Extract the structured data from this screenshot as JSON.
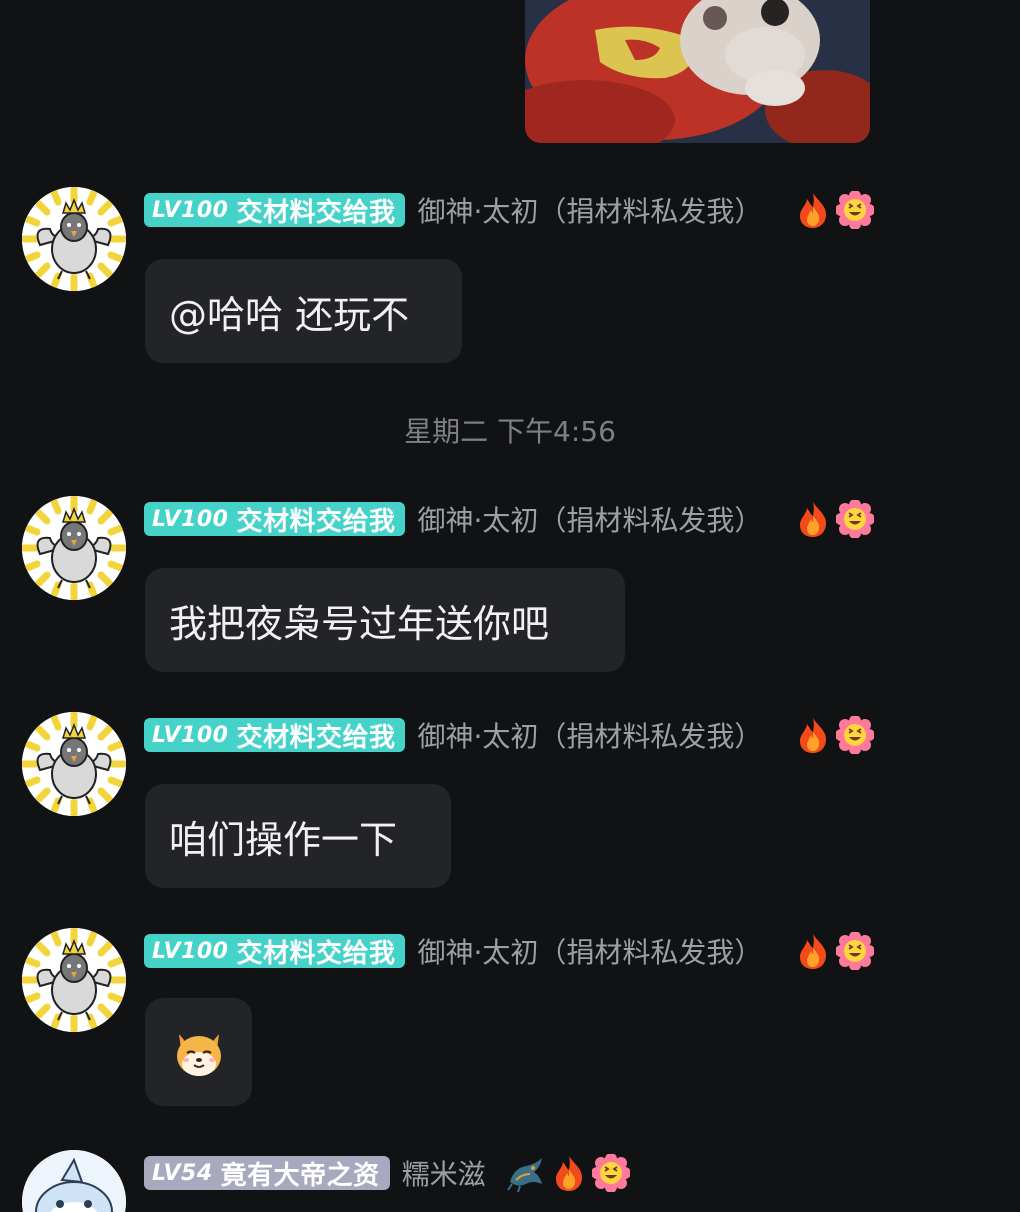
{
  "colors": {
    "background": "#111214",
    "bubble": "#232427",
    "badge_teal": "#45d3c9",
    "badge_grey": "#a8a8bf",
    "nickname": "#9d9fa6"
  },
  "top_image": {
    "icon": "video-thumbnail"
  },
  "timestamp": "星期二 下午4:56",
  "messages": [
    {
      "level": "LV100",
      "badge_title": "交材料交给我",
      "nickname": "御神·太初（捐材料私发我）",
      "icons": [
        "fire-icon",
        "flower-emoji-icon"
      ],
      "text": "@哈哈 还玩不"
    },
    {
      "level": "LV100",
      "badge_title": "交材料交给我",
      "nickname": "御神·太初（捐材料私发我）",
      "icons": [
        "fire-icon",
        "flower-emoji-icon"
      ],
      "text": "我把夜枭号过年送你吧"
    },
    {
      "level": "LV100",
      "badge_title": "交材料交给我",
      "nickname": "御神·太初（捐材料私发我）",
      "icons": [
        "fire-icon",
        "flower-emoji-icon"
      ],
      "text": "咱们操作一下"
    },
    {
      "level": "LV100",
      "badge_title": "交材料交给我",
      "nickname": "御神·太初（捐材料私发我）",
      "icons": [
        "fire-icon",
        "flower-emoji-icon"
      ],
      "sticker": "shiba-dog-sticker"
    },
    {
      "level": "LV54",
      "badge_title": "竟有大帝之资",
      "nickname": "糯米滋",
      "icons": [
        "dragon-icon",
        "fire-icon",
        "flower-emoji-icon"
      ]
    }
  ]
}
